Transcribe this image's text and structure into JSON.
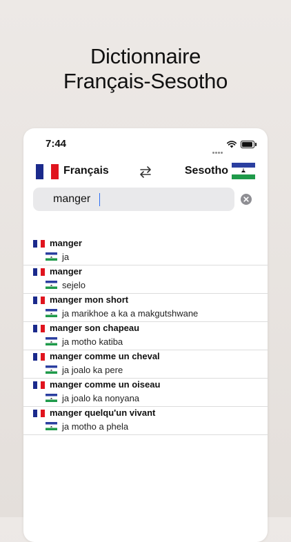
{
  "headline": {
    "line1": "Dictionnaire",
    "line2": "Français-Sesotho"
  },
  "status_bar": {
    "time": "7:44"
  },
  "language_bar": {
    "source_lang": "Français",
    "target_lang": "Sesotho",
    "source_flag": "france-flag",
    "target_flag": "lesotho-flag",
    "swap_icon": "swap-arrows-icon"
  },
  "search": {
    "value": "manger",
    "clear_icon": "clear-icon"
  },
  "results": [
    {
      "term": "manger",
      "translation": "ja"
    },
    {
      "term": "manger",
      "translation": "sejelo"
    },
    {
      "term": "manger mon short",
      "translation": "ja marikhoe a ka a makgutshwane"
    },
    {
      "term": "manger son chapeau",
      "translation": "ja motho katiba"
    },
    {
      "term": "manger comme un cheval",
      "translation": "ja joalo ka pere"
    },
    {
      "term": "manger comme un oiseau",
      "translation": "ja joalo ka nonyana"
    },
    {
      "term": "manger quelqu'un vivant",
      "translation": "ja motho a phela"
    }
  ],
  "colors": {
    "background": "#e9e5e2",
    "france_blue": "#1b2a8c",
    "france_red": "#e0141e",
    "lesotho_blue": "#2b3fa0",
    "lesotho_green": "#1f9a4a",
    "caret": "#2a6df4"
  }
}
